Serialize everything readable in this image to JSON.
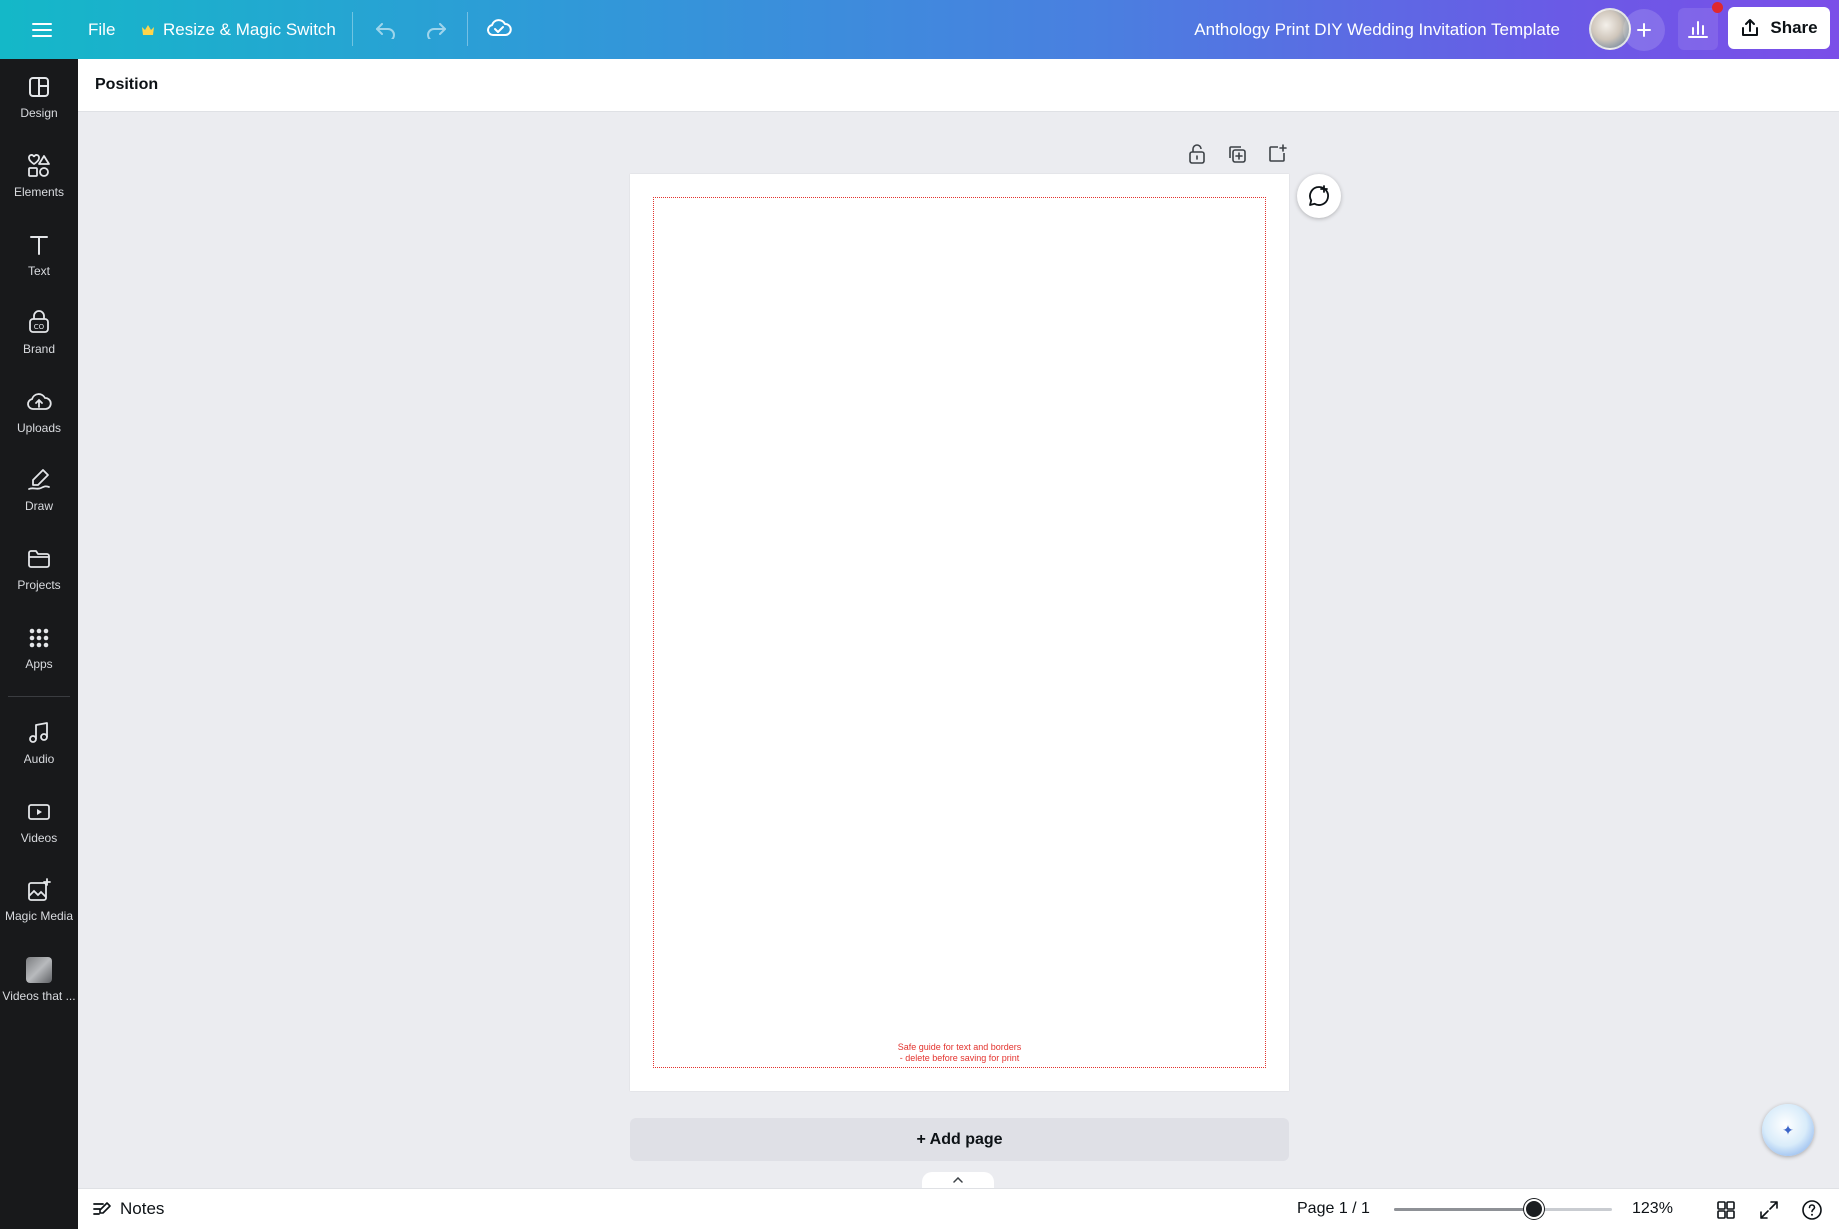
{
  "topbar": {
    "menu_icon": "hamburger-icon",
    "file_label": "File",
    "resize_label": "Resize & Magic Switch",
    "undo_icon": "undo-icon",
    "redo_icon": "redo-icon",
    "save_status_icon": "cloud-check-icon",
    "document_title": "Anthology Print DIY Wedding Invitation Template",
    "share_label": "Share",
    "accent_start": "#14b8c8",
    "accent_end": "#7b4ee8"
  },
  "sidebar": {
    "items": [
      {
        "label": "Design",
        "icon": "design-icon"
      },
      {
        "label": "Elements",
        "icon": "elements-icon"
      },
      {
        "label": "Text",
        "icon": "text-icon"
      },
      {
        "label": "Brand",
        "icon": "brand-icon"
      },
      {
        "label": "Uploads",
        "icon": "cloud-upload-icon"
      },
      {
        "label": "Draw",
        "icon": "pen-icon"
      },
      {
        "label": "Projects",
        "icon": "folder-icon"
      },
      {
        "label": "Apps",
        "icon": "apps-grid-icon"
      },
      {
        "label": "Audio",
        "icon": "music-note-icon"
      },
      {
        "label": "Videos",
        "icon": "video-icon"
      },
      {
        "label": "Magic Media",
        "icon": "magic-media-icon"
      },
      {
        "label": "Videos that ...",
        "icon": "app-thumbnail-icon"
      }
    ]
  },
  "context_toolbar": {
    "position_label": "Position"
  },
  "canvas": {
    "safe_guide_line1": "Safe guide for text and borders",
    "safe_guide_line2": "- delete before saving for print",
    "add_page_label": "+ Add page",
    "guide_color": "#e3342f"
  },
  "bottombar": {
    "notes_label": "Notes",
    "page_counter": "Page 1 / 1",
    "zoom_label": "123%",
    "zoom_slider_fraction": 0.64
  }
}
